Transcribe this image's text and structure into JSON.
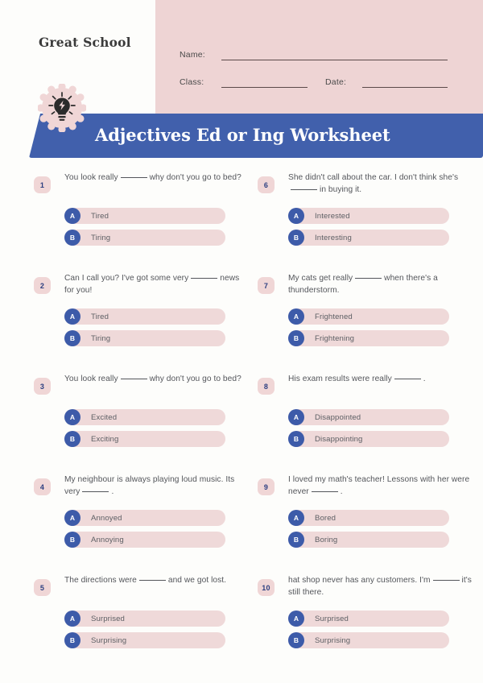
{
  "header": {
    "school_name": "Great School",
    "pink_color": "#eed4d4",
    "fields": [
      {
        "label": "Name:"
      },
      {
        "label": "Class:"
      },
      {
        "label": "Date:"
      }
    ],
    "badge_icon": "lightbulb-lightning-badge-icon"
  },
  "banner": {
    "title": "Adjectives Ed or Ing Worksheet",
    "color": "#4160ac"
  },
  "questions": [
    {
      "number": "1",
      "text_before": "You look really",
      "text_after": "why don't you go to bed?",
      "options": [
        {
          "key": "A",
          "label": "Tired"
        },
        {
          "key": "B",
          "label": "Tiring"
        }
      ]
    },
    {
      "number": "2",
      "text_before": "Can I call you? I've got some very",
      "text_after": "news for you!",
      "options": [
        {
          "key": "A",
          "label": "Tired"
        },
        {
          "key": "B",
          "label": "Tiring"
        }
      ]
    },
    {
      "number": "3",
      "text_before": "You look really",
      "text_after": "why don't you go to bed?",
      "options": [
        {
          "key": "A",
          "label": "Excited"
        },
        {
          "key": "B",
          "label": "Exciting"
        }
      ]
    },
    {
      "number": "4",
      "text_before": "My neighbour is always playing loud music. Its very",
      "text_after": ".",
      "options": [
        {
          "key": "A",
          "label": "Annoyed"
        },
        {
          "key": "B",
          "label": "Annoying"
        }
      ]
    },
    {
      "number": "5",
      "text_before": "The directions were",
      "text_after": "and we got lost.",
      "options": [
        {
          "key": "A",
          "label": "Surprised"
        },
        {
          "key": "B",
          "label": "Surprising"
        }
      ]
    },
    {
      "number": "6",
      "text_before": "She didn't call about the car. I don't think she's",
      "text_after": "in buying it.",
      "options": [
        {
          "key": "A",
          "label": "Interested"
        },
        {
          "key": "B",
          "label": "Interesting"
        }
      ]
    },
    {
      "number": "7",
      "text_before": "My cats get really",
      "text_after": "when there's a thunderstorm.",
      "options": [
        {
          "key": "A",
          "label": "Frightened"
        },
        {
          "key": "B",
          "label": "Frightening"
        }
      ]
    },
    {
      "number": "8",
      "text_before": "His exam results were really",
      "text_after": ".",
      "options": [
        {
          "key": "A",
          "label": "Disappointed"
        },
        {
          "key": "B",
          "label": "Disappointing"
        }
      ]
    },
    {
      "number": "9",
      "text_before": "I loved my math's teacher! Lessons with her were never",
      "text_after": ".",
      "options": [
        {
          "key": "A",
          "label": "Bored"
        },
        {
          "key": "B",
          "label": "Boring"
        }
      ]
    },
    {
      "number": "10",
      "text_before": "hat shop never has any customers. I'm",
      "text_after": "it's still there.",
      "options": [
        {
          "key": "A",
          "label": "Surprised"
        },
        {
          "key": "B",
          "label": "Surprising"
        }
      ]
    }
  ],
  "colors": {
    "accent_blue": "#3d5ba9",
    "pill_pink": "#efd9d9",
    "badge_pink": "#f0d6d6",
    "text_gray": "#54565b"
  }
}
